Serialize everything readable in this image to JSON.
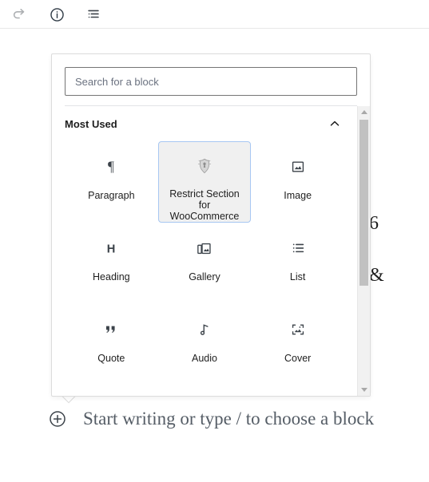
{
  "toolbar": {
    "items": [
      {
        "name": "redo-icon",
        "label": "Redo",
        "disabled": true
      },
      {
        "name": "info-icon",
        "label": "Details",
        "disabled": false
      },
      {
        "name": "list-view-icon",
        "label": "List view",
        "disabled": false
      }
    ]
  },
  "inserter": {
    "search": {
      "placeholder": "Search for a block",
      "value": ""
    },
    "panel": {
      "title": "Most Used",
      "chevron": "chevron-up-icon",
      "expanded": true
    },
    "blocks": [
      {
        "label": "Paragraph",
        "icon": "paragraph-icon",
        "selected": false
      },
      {
        "label": "Restrict Section for WooCommerce",
        "icon": "restrict-section-woocommerce-icon",
        "selected": true
      },
      {
        "label": "Image",
        "icon": "image-icon",
        "selected": false
      },
      {
        "label": "Heading",
        "icon": "heading-icon",
        "selected": false
      },
      {
        "label": "Gallery",
        "icon": "gallery-icon",
        "selected": false
      },
      {
        "label": "List",
        "icon": "list-icon",
        "selected": false
      },
      {
        "label": "Quote",
        "icon": "quote-icon",
        "selected": false
      },
      {
        "label": "Audio",
        "icon": "audio-icon",
        "selected": false
      },
      {
        "label": "Cover",
        "icon": "cover-icon",
        "selected": false
      }
    ],
    "scrollbar": {
      "up_arrow": "scroll-up-arrow",
      "down_arrow": "scroll-down-arrow"
    }
  },
  "canvas": {
    "placeholder": "Start writing or type / to choose a block",
    "inserter_icon": "add-block-plus-icon",
    "background_fragments": [
      {
        "text": "6"
      },
      {
        "text": "&"
      }
    ]
  },
  "colors": {
    "selection_border": "#a7c7f2",
    "selection_fill": "#f0f0f0",
    "text": "#1e1e1e",
    "muted_text": "#555d66",
    "border": "#dcdcdc"
  }
}
